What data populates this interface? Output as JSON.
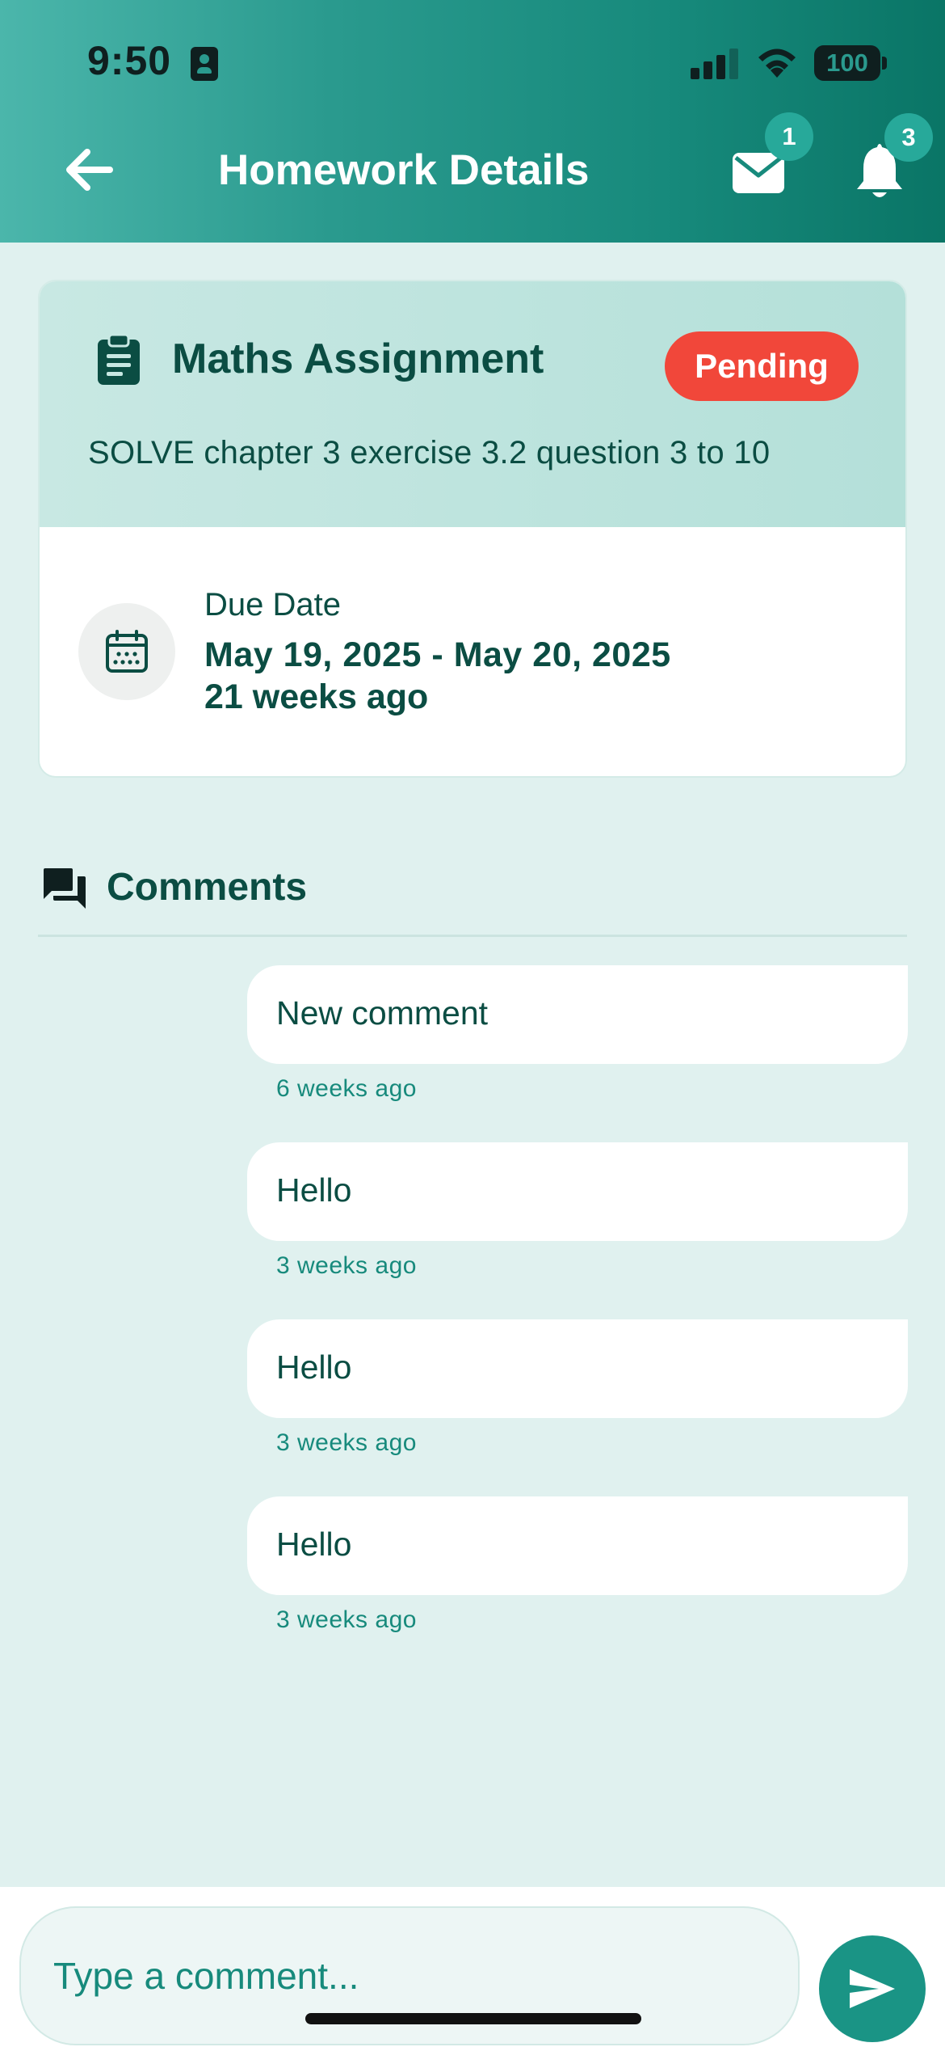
{
  "status_bar": {
    "time": "9:50",
    "battery": "100"
  },
  "header": {
    "title": "Homework Details",
    "mail_badge": "1",
    "bell_badge": "3"
  },
  "homework": {
    "title": "Maths Assignment",
    "status": "Pending",
    "description": "SOLVE chapter 3 exercise 3.2 question 3 to 10",
    "due_label": "Due Date",
    "due_range": "May 19, 2025 - May 20, 2025",
    "due_relative": "21 weeks ago"
  },
  "comments": {
    "title": "Comments",
    "items": [
      {
        "text": "New comment",
        "time": "6 weeks ago"
      },
      {
        "text": "Hello",
        "time": "3 weeks ago"
      },
      {
        "text": "Hello",
        "time": "3 weeks ago"
      },
      {
        "text": "Hello",
        "time": "3 weeks ago"
      }
    ]
  },
  "composer": {
    "placeholder": "Type a comment..."
  },
  "colors": {
    "header_start": "#4bb6ab",
    "header_end": "#0a7566",
    "text_dark": "#0b4d43",
    "accent": "#1a9485",
    "pending": "#f1473a",
    "background": "#e0f1ef"
  },
  "icons": [
    "back-arrow-icon",
    "mail-icon",
    "bell-icon",
    "clipboard-icon",
    "calendar-icon",
    "comments-icon",
    "send-icon"
  ]
}
